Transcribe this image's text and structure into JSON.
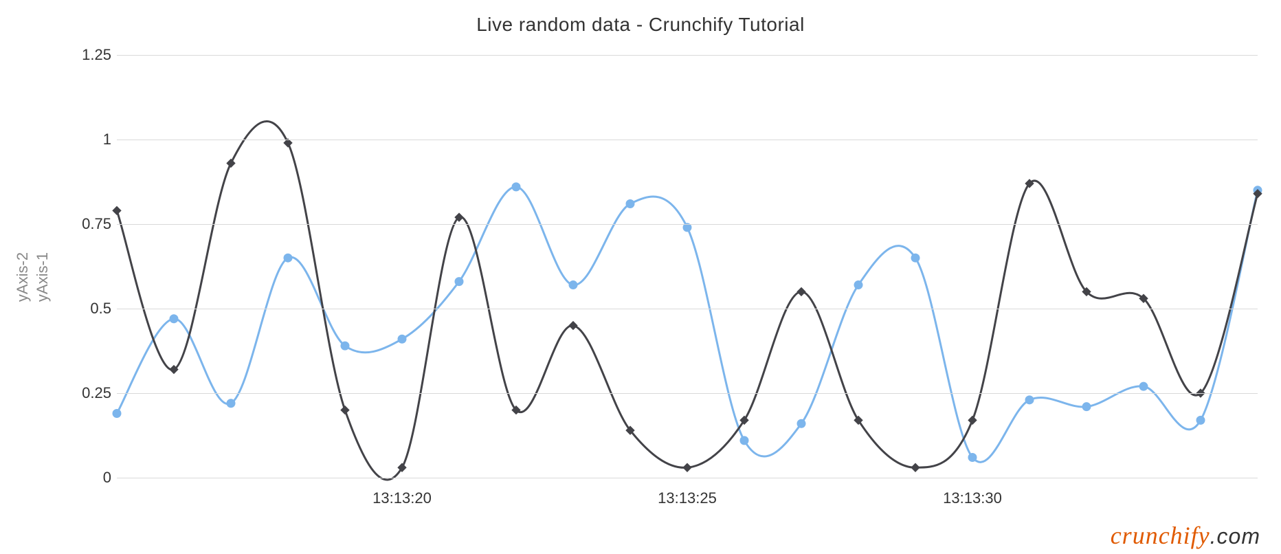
{
  "chart_data": {
    "type": "line",
    "title": "Live random data - Crunchify Tutorial",
    "xlabel": "",
    "ylabels": [
      "yAxis-1",
      "yAxis-2"
    ],
    "ylim": [
      0,
      1.25
    ],
    "yticks": [
      0,
      0.25,
      0.5,
      0.75,
      1,
      1.25
    ],
    "x_tick_labels": [
      "13:13:20",
      "13:13:25",
      "13:13:30"
    ],
    "x": [
      15,
      16,
      17,
      18,
      19,
      20,
      21,
      22,
      23,
      24,
      25,
      26,
      27,
      28,
      29,
      30,
      31,
      32,
      33,
      34,
      35
    ],
    "series": [
      {
        "name": "yAxis-1",
        "color": "#7cb5ec",
        "marker": "circle",
        "values": [
          0.19,
          0.47,
          0.22,
          0.65,
          0.39,
          0.41,
          0.58,
          0.86,
          0.57,
          0.81,
          0.74,
          0.11,
          0.16,
          0.57,
          0.65,
          0.06,
          0.23,
          0.21,
          0.27,
          0.17,
          0.85
        ]
      },
      {
        "name": "yAxis-2",
        "color": "#434348",
        "marker": "diamond",
        "values": [
          0.79,
          0.32,
          0.93,
          0.99,
          0.2,
          0.03,
          0.77,
          0.2,
          0.45,
          0.14,
          0.03,
          0.17,
          0.55,
          0.17,
          0.03,
          0.17,
          0.87,
          0.55,
          0.53,
          0.25,
          0.84
        ]
      }
    ]
  },
  "watermark": {
    "brand": "crunchify",
    "suffix": ".com"
  }
}
